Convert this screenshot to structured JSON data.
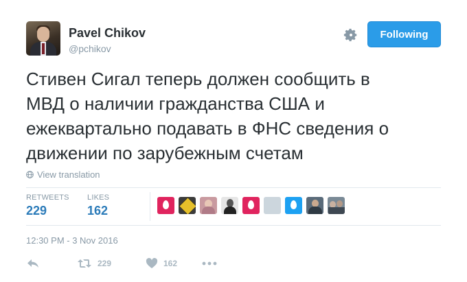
{
  "author": {
    "display_name": "Pavel Chikov",
    "screen_name": "@pchikov"
  },
  "header": {
    "settings_icon": "gear-icon",
    "follow_label": "Following",
    "follow_color": "#2b9ce8"
  },
  "tweet": {
    "text": "Стивен Сигал теперь должен сообщить в\nМВД о наличии гражданства США и\nежеквартально подавать в ФНС сведения о\nдвижении по зарубежным счетам",
    "translate_label": "View translation",
    "translate_icon": "globe-icon"
  },
  "stats": {
    "retweets_label": "RETWEETS",
    "retweets_value": "229",
    "likes_label": "LIKES",
    "likes_value": "162"
  },
  "likers": [
    {
      "icon": "default-egg-avatar",
      "color": "#e0245e"
    },
    {
      "icon": "road-sign-avatar",
      "color": "#c9a227"
    },
    {
      "icon": "photo-avatar",
      "color": "#c99aa0"
    },
    {
      "icon": "photo-avatar",
      "color": "#d9d9d9"
    },
    {
      "icon": "default-egg-avatar",
      "color": "#e0245e"
    },
    {
      "icon": "blank-avatar",
      "color": "#ccd6dd"
    },
    {
      "icon": "default-egg-avatar",
      "color": "#1da1f2"
    },
    {
      "icon": "photo-avatar",
      "color": "#5a6b7a"
    },
    {
      "icon": "photo-avatar",
      "color": "#7a8a96"
    }
  ],
  "timestamp": "12:30 PM - 3 Nov 2016",
  "actions": {
    "reply_icon": "reply-icon",
    "retweet_icon": "retweet-icon",
    "retweet_count": "229",
    "like_icon": "heart-icon",
    "like_count": "162",
    "more_icon": "more-icon"
  }
}
